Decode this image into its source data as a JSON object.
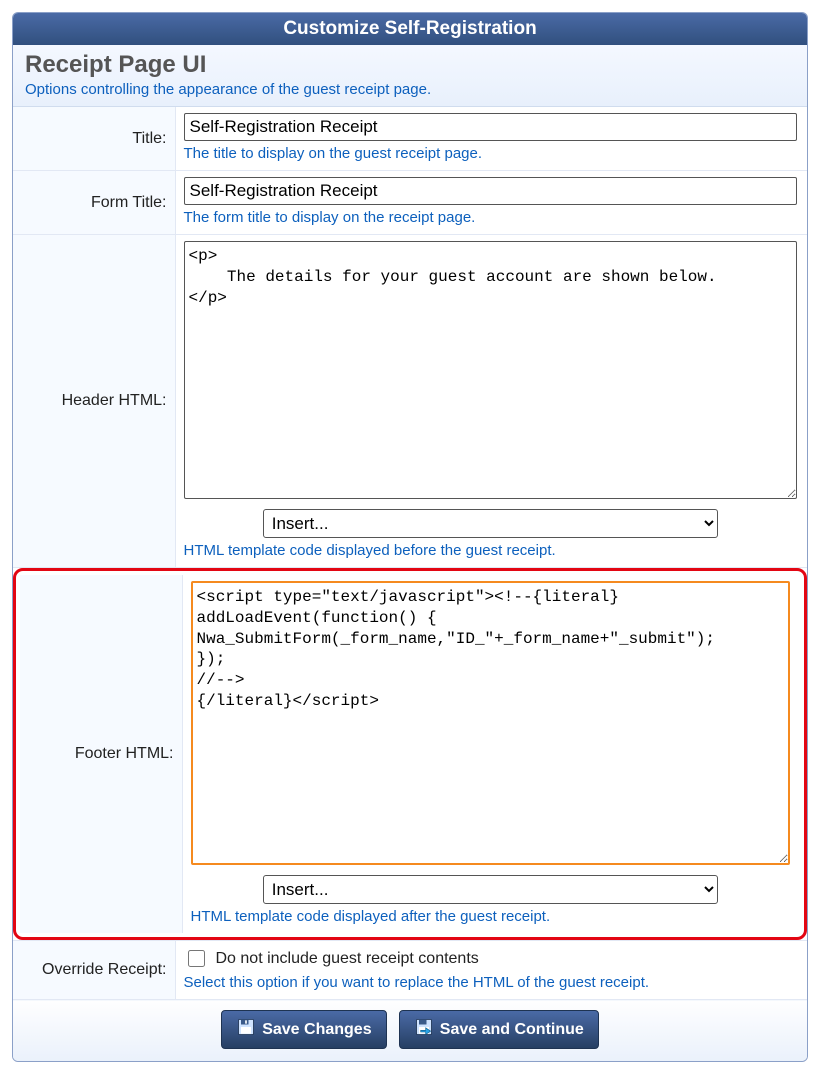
{
  "header": {
    "title": "Customize Self-Registration"
  },
  "section": {
    "title": "Receipt Page UI",
    "desc": "Options controlling the appearance of the guest receipt page."
  },
  "fields": {
    "title": {
      "label": "Title:",
      "value": "Self-Registration Receipt",
      "help": "The title to display on the guest receipt page."
    },
    "formTitle": {
      "label": "Form Title:",
      "value": "Self-Registration Receipt",
      "help": "The form title to display on the receipt page."
    },
    "headerHtml": {
      "label": "Header HTML:",
      "value": "<p>\n    The details for your guest account are shown below.\n</p>",
      "insert": "Insert...",
      "help": "HTML template code displayed before the guest receipt."
    },
    "footerHtml": {
      "label": "Footer HTML:",
      "value": "<script type=\"text/javascript\"><!--{literal}\naddLoadEvent(function() {\nNwa_SubmitForm(_form_name,\"ID_\"+_form_name+\"_submit\");\n});\n//-->\n{/literal}</script>",
      "insert": "Insert...",
      "help": "HTML template code displayed after the guest receipt."
    },
    "override": {
      "label": "Override Receipt:",
      "checkboxLabel": "Do not include guest receipt contents",
      "help": "Select this option if you want to replace the HTML of the guest receipt."
    }
  },
  "buttons": {
    "save": "Save Changes",
    "continue": "Save and Continue"
  }
}
